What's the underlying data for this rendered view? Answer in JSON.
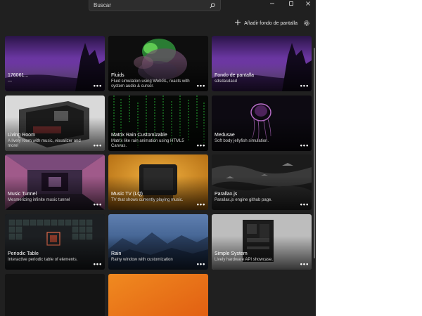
{
  "search": {
    "placeholder": "Buscar",
    "icon": "search-icon"
  },
  "window": {
    "minimize_icon": "minimize-icon",
    "maximize_icon": "maximize-icon",
    "close_icon": "close-icon"
  },
  "toolbar": {
    "add_label": "Añadir fondo de pantalla",
    "add_icon": "plus-icon",
    "settings_icon": "gear-icon"
  },
  "wallpapers": [
    {
      "title": "176061...",
      "description": "—",
      "more": "•••"
    },
    {
      "title": "Fluids",
      "description": "Fluid simulation using WebGL, reacts with system audio & cursor.",
      "more": "•••"
    },
    {
      "title": "Fondo de pantalla",
      "description": "sdsdasdasd",
      "more": "•••"
    },
    {
      "title": "Living Room",
      "description": "A lively room with music, visualizer and more!",
      "more": "•••"
    },
    {
      "title": "Matrix Rain Customizable",
      "description": "Matrix like rain animation using HTML5 Canvas.",
      "more": "•••"
    },
    {
      "title": "Medusae",
      "description": "Soft body jellyfish simulation.",
      "more": "•••"
    },
    {
      "title": "Music Tunnel",
      "description": "Mesmerizing infinite music tunnel",
      "more": "•••"
    },
    {
      "title": "Music TV (LQ)",
      "description": "TV that shows currently playing music.",
      "more": "•••"
    },
    {
      "title": "Parallax.js",
      "description": "Parallax.js engine github page.",
      "more": "•••"
    },
    {
      "title": "Periodic Table",
      "description": "Interactive periodic table of elements.",
      "more": "•••"
    },
    {
      "title": "Rain",
      "description": "Rainy window with customization",
      "more": "•••"
    },
    {
      "title": "Simple System",
      "description": "Lively hardware API showcase.",
      "more": "•••"
    }
  ]
}
